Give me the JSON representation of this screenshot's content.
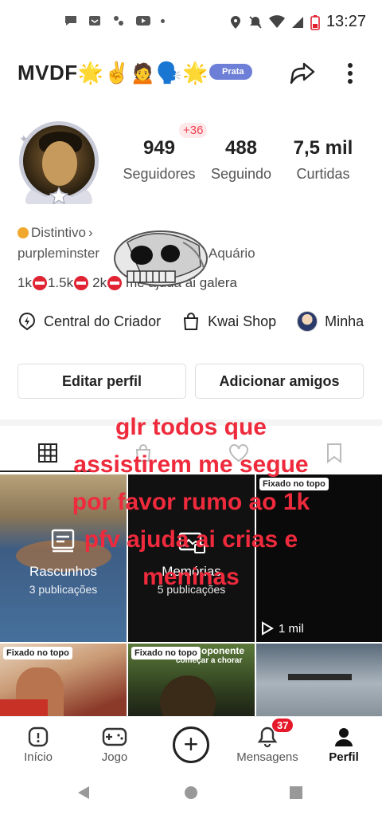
{
  "status_bar": {
    "time": "13:27"
  },
  "header": {
    "username": "MVDF🌟✌️🙍🗣️🌟",
    "badge": "Prata"
  },
  "profile": {
    "new_followers": "+36",
    "stats": [
      {
        "value": "949",
        "label": "Seguidores"
      },
      {
        "value": "488",
        "label": "Seguindo"
      },
      {
        "value": "7,5 mil",
        "label": "Curtidas"
      }
    ],
    "distinctive_label": "Distintivo",
    "handle": "purpleminster",
    "zodiac": "Aquário",
    "bio_parts": [
      "1k",
      "1.5k",
      "2k",
      "me ajuda ai galera"
    ]
  },
  "links": [
    {
      "icon": "creator-center-icon",
      "label": "Central do Criador"
    },
    {
      "icon": "shop-bag-icon",
      "label": "Kwai Shop"
    },
    {
      "icon": "avatar-icon",
      "label": "Minha"
    }
  ],
  "buttons": {
    "edit_profile": "Editar perfil",
    "add_friends": "Adicionar amigos"
  },
  "overlay_text": [
    "glr todos que",
    "assistirem me segue",
    "por favor rumo ao 1k",
    "pfv ajuda ai crias e",
    "meninas"
  ],
  "grid": {
    "drafts": {
      "title": "Rascunhos",
      "subtitle": "3 publicações"
    },
    "memories": {
      "title": "Memórias",
      "subtitle": "5 publicações"
    },
    "pinned_label": "Fixado no topo",
    "views": "1 mil",
    "caption_fragment_1": "oponente",
    "caption_fragment_2": "começar a chorar"
  },
  "bottom_nav": [
    {
      "label": "Início"
    },
    {
      "label": "Jogo"
    },
    {
      "label": "Mensagens",
      "badge": "37"
    },
    {
      "label": "Perfil"
    }
  ]
}
